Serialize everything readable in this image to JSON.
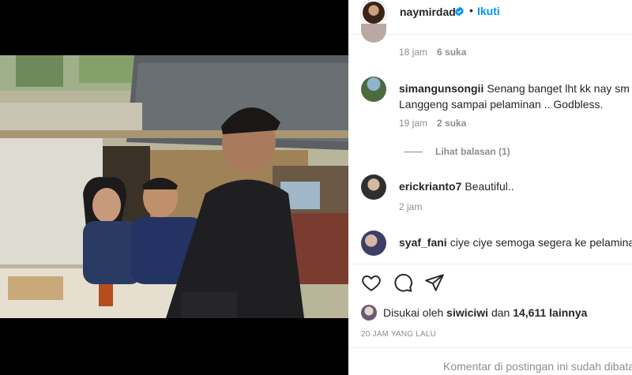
{
  "post": {
    "author": "naymirdad",
    "follow_label": "Ikuti",
    "separator": "•"
  },
  "comments": {
    "first_meta": {
      "time": "18 jam",
      "likes": "6 suka"
    },
    "items": [
      {
        "user": "simangunsongii",
        "text_line1": "Senang banget lht kk nay sm kk",
        "text_line2": "Langgeng sampai pelaminan .. Godbless.",
        "time": "19 jam",
        "likes": "2 suka"
      },
      {
        "user": "erickrianto7",
        "text_line1": "Beautiful..",
        "time": "2 jam"
      },
      {
        "user": "syaf_fani",
        "text_line1": "ciye ciye semoga segera ke pelaminan"
      }
    ],
    "view_replies": "Lihat balasan (1)"
  },
  "likes": {
    "prefix": "Disukai oleh",
    "user": "siwiciwi",
    "conj": "dan",
    "count": "14,611 lainnya"
  },
  "timestamp": "20 JAM YANG LALU",
  "comments_closed": "Komentar di postingan ini sudah dibatasi.",
  "icons": {
    "like": "heart-icon",
    "comment": "comment-icon",
    "share": "send-icon",
    "verified": "verified-badge-icon"
  },
  "colors": {
    "accent": "#0095f6",
    "text": "#262626",
    "muted": "#8e8e8e"
  }
}
